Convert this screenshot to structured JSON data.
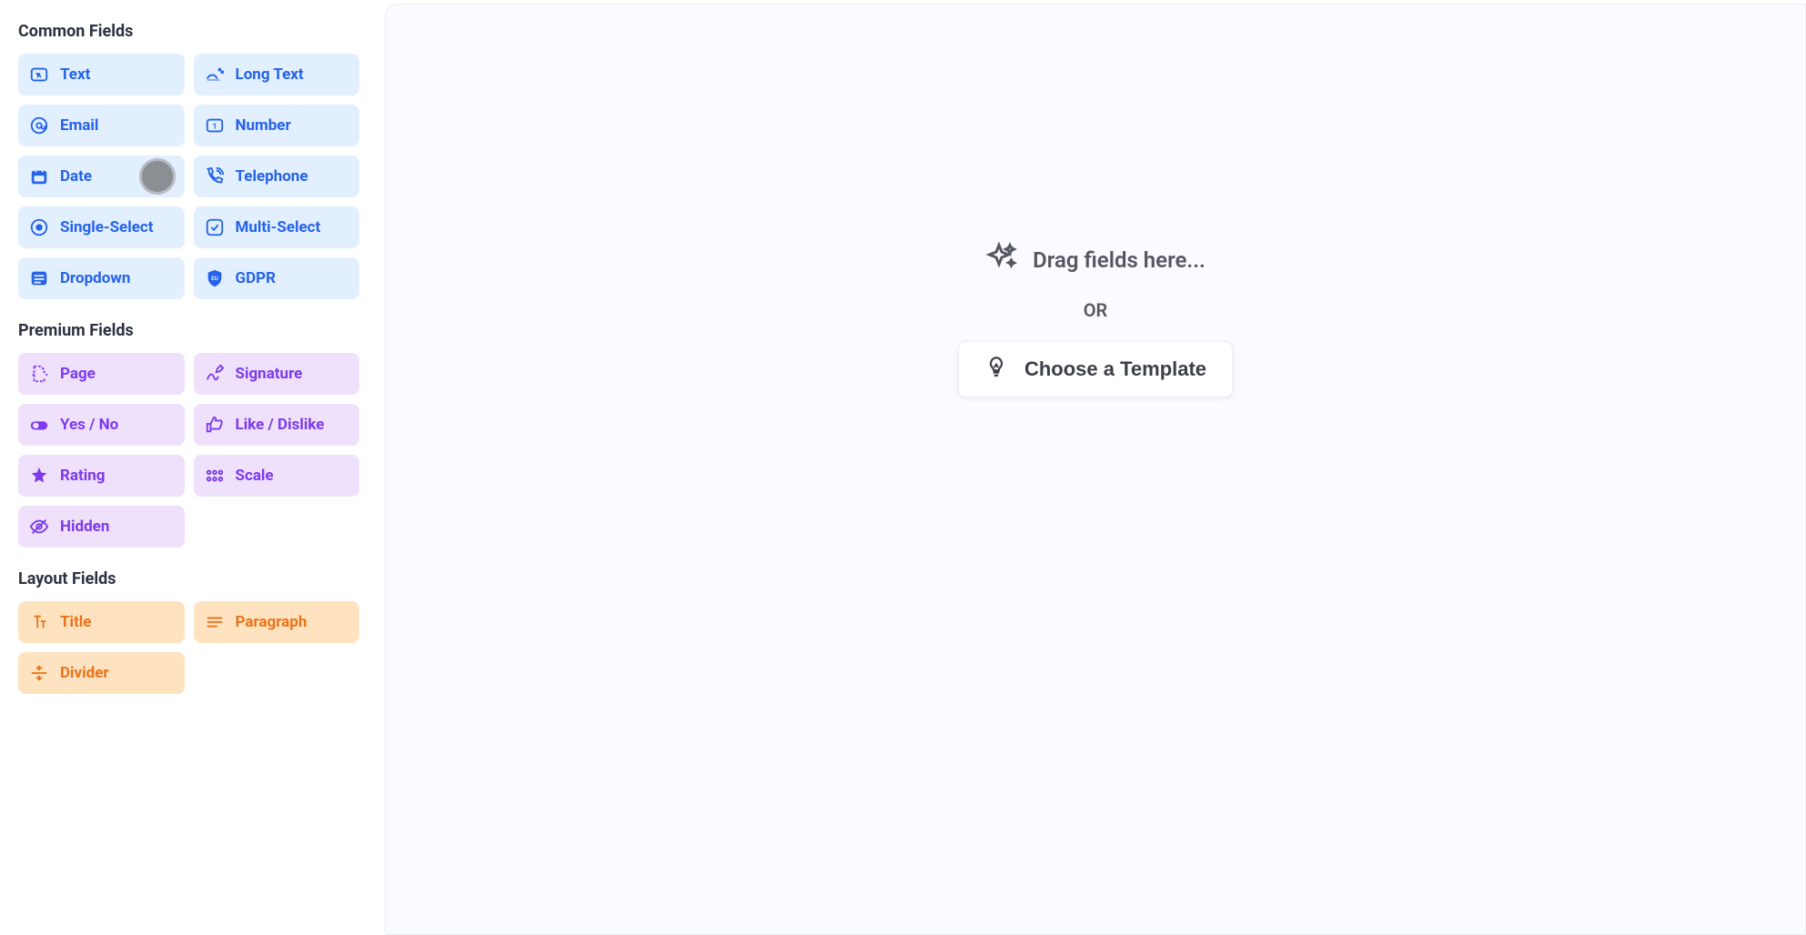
{
  "sidebar": {
    "sections": {
      "common": {
        "heading": "Common Fields",
        "fields": {
          "text": "Text",
          "long_text": "Long Text",
          "email": "Email",
          "number": "Number",
          "date": "Date",
          "telephone": "Telephone",
          "single_select": "Single-Select",
          "multi_select": "Multi-Select",
          "dropdown": "Dropdown",
          "gdpr": "GDPR"
        }
      },
      "premium": {
        "heading": "Premium Fields",
        "fields": {
          "page": "Page",
          "signature": "Signature",
          "yes_no": "Yes / No",
          "like_dislike": "Like / Dislike",
          "rating": "Rating",
          "scale": "Scale",
          "hidden": "Hidden"
        }
      },
      "layout": {
        "heading": "Layout Fields",
        "fields": {
          "title": "Title",
          "paragraph": "Paragraph",
          "divider": "Divider"
        }
      }
    }
  },
  "canvas": {
    "drag_hint": "Drag fields here...",
    "or_label": "OR",
    "template_button": "Choose a Template"
  },
  "colors": {
    "common": "#2563eb",
    "premium": "#7c3aed",
    "layout": "#ea7317"
  }
}
